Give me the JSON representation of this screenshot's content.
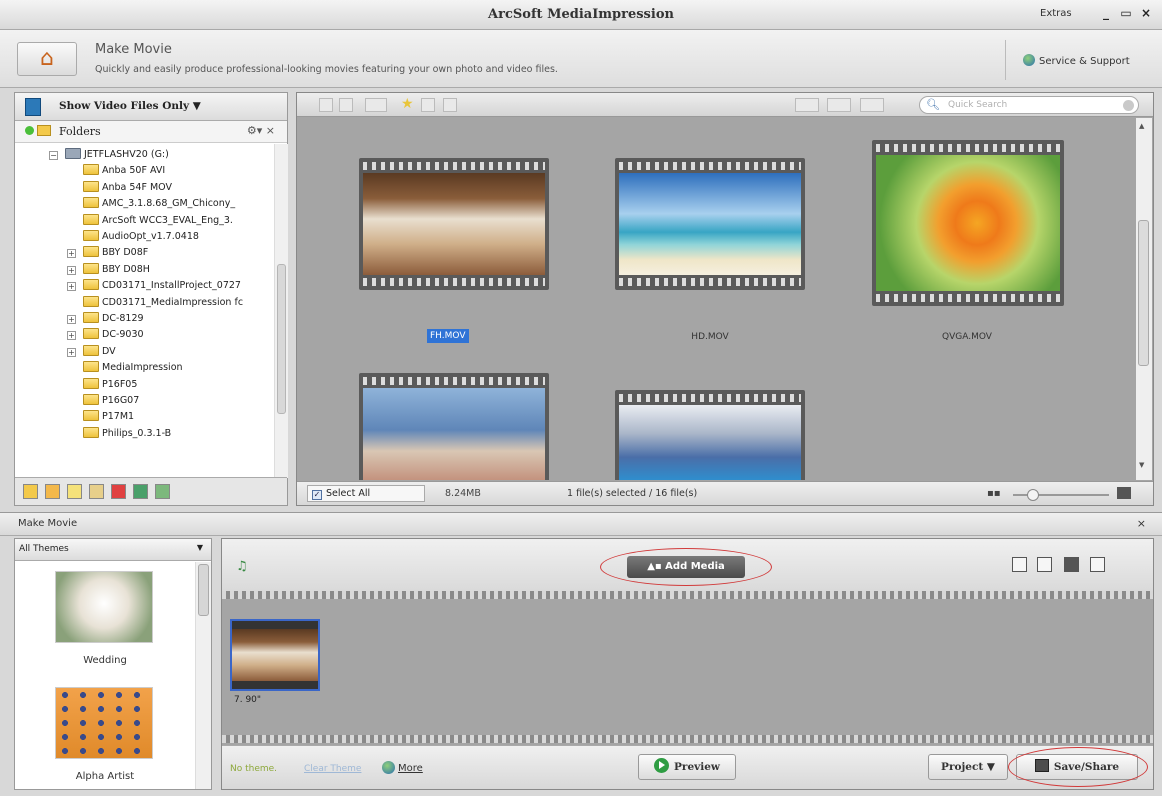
{
  "window": {
    "title": "ArcSoft MediaImpression",
    "extras": "Extras",
    "minimize": "_",
    "maximize": "▭",
    "close": "×"
  },
  "header": {
    "title": "Make Movie",
    "subtitle": "Quickly and easily produce professional-looking movies featuring your own photo and video files.",
    "service": "Service & Support"
  },
  "browser": {
    "filter_label": "Show Video Files Only ▼",
    "folders_label": "Folders",
    "folders_opts": "⚙▾ ×",
    "tree": [
      {
        "label": "JETFLASHV20 (G:)",
        "expander": "−"
      },
      {
        "label": "Anba 50F AVI"
      },
      {
        "label": "Anba 54F MOV"
      },
      {
        "label": "AMC_3.1.8.68_GM_Chicony_"
      },
      {
        "label": "ArcSoft WCC3_EVAL_Eng_3."
      },
      {
        "label": "AudioOpt_v1.7.0418"
      },
      {
        "label": "BBY D08F",
        "expander": "+"
      },
      {
        "label": "BBY D08H",
        "expander": "+"
      },
      {
        "label": "CD03171_InstallProject_0727",
        "expander": "+"
      },
      {
        "label": "CD03171_MediaImpression fc"
      },
      {
        "label": "DC-8129",
        "expander": "+"
      },
      {
        "label": "DC-9030",
        "expander": "+"
      },
      {
        "label": "DV",
        "expander": "+"
      },
      {
        "label": "MediaImpression"
      },
      {
        "label": "P16F05"
      },
      {
        "label": "P16G07"
      },
      {
        "label": "P17M1"
      },
      {
        "label": "Philips_0.3.1-B"
      }
    ]
  },
  "content": {
    "search_placeholder": "Quick Search",
    "files": [
      {
        "name": "FH.MOV",
        "selected": true
      },
      {
        "name": "HD.MOV",
        "selected": false
      },
      {
        "name": "QVGA.MOV",
        "selected": false
      }
    ],
    "select_all": "Select All",
    "size": "8.24MB",
    "selection_info": "1 file(s) selected / 16 file(s)"
  },
  "make_movie": {
    "section_title": "Make Movie",
    "close": "×",
    "themes_dropdown": "All Themes",
    "themes": [
      {
        "name": "Wedding"
      },
      {
        "name": "Alpha Artist"
      }
    ],
    "add_media": "Add Media",
    "clip_duration": "7. 90\"",
    "no_theme": "No theme.",
    "clear_theme": "Clear Theme",
    "more": "More",
    "preview": "Preview",
    "project": "Project ▼",
    "save_share": "Save/Share"
  },
  "colors": {
    "accent_blue": "#2f73d6",
    "annotation_red": "#d13a3a",
    "preview_green": "#2f9d43"
  }
}
